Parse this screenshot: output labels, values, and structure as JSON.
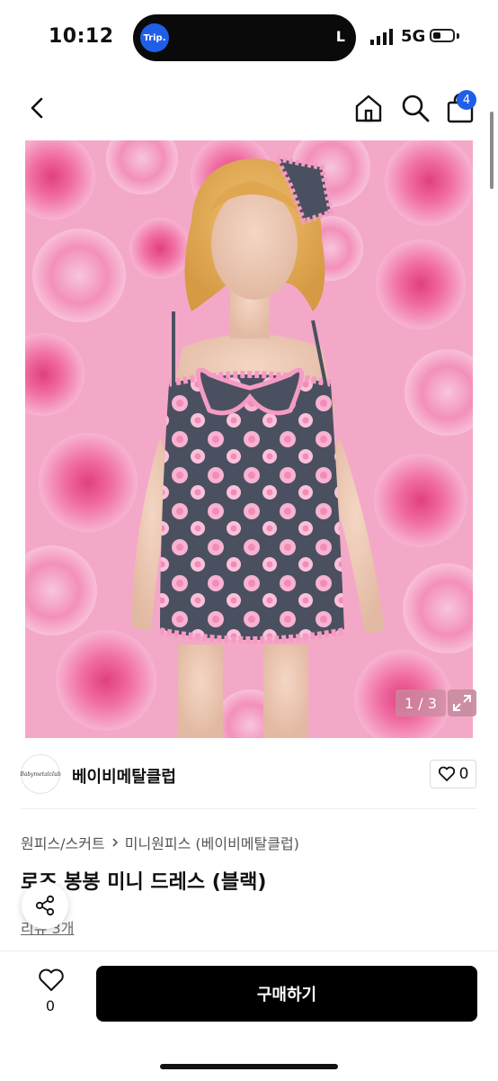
{
  "status": {
    "time": "10:12",
    "island_app": "Trip.",
    "island_right": "L",
    "network": "5G",
    "battery_level": 0.4
  },
  "nav": {
    "cart_count": "4",
    "icons": [
      "back-arrow-icon",
      "home-icon",
      "search-icon",
      "cart-icon"
    ]
  },
  "gallery": {
    "counter": "1 / 3",
    "image_description_colors": {
      "background": "#f3a6c8",
      "dress": "#4b5060",
      "rose": "#f7b3d2"
    }
  },
  "shop": {
    "logo_text": "Babymetalclub",
    "name": "베이비메탈클럽",
    "like_count": "0"
  },
  "product": {
    "breadcrumb": [
      "원피스/스커트",
      "미니원피스 (베이비메탈클럽)"
    ],
    "title": "로즈 봉봉 미니 드레스 (블랙)",
    "reviews": "리뷰 3개"
  },
  "bottom": {
    "wish_count": "0",
    "buy_label": "구매하기"
  }
}
